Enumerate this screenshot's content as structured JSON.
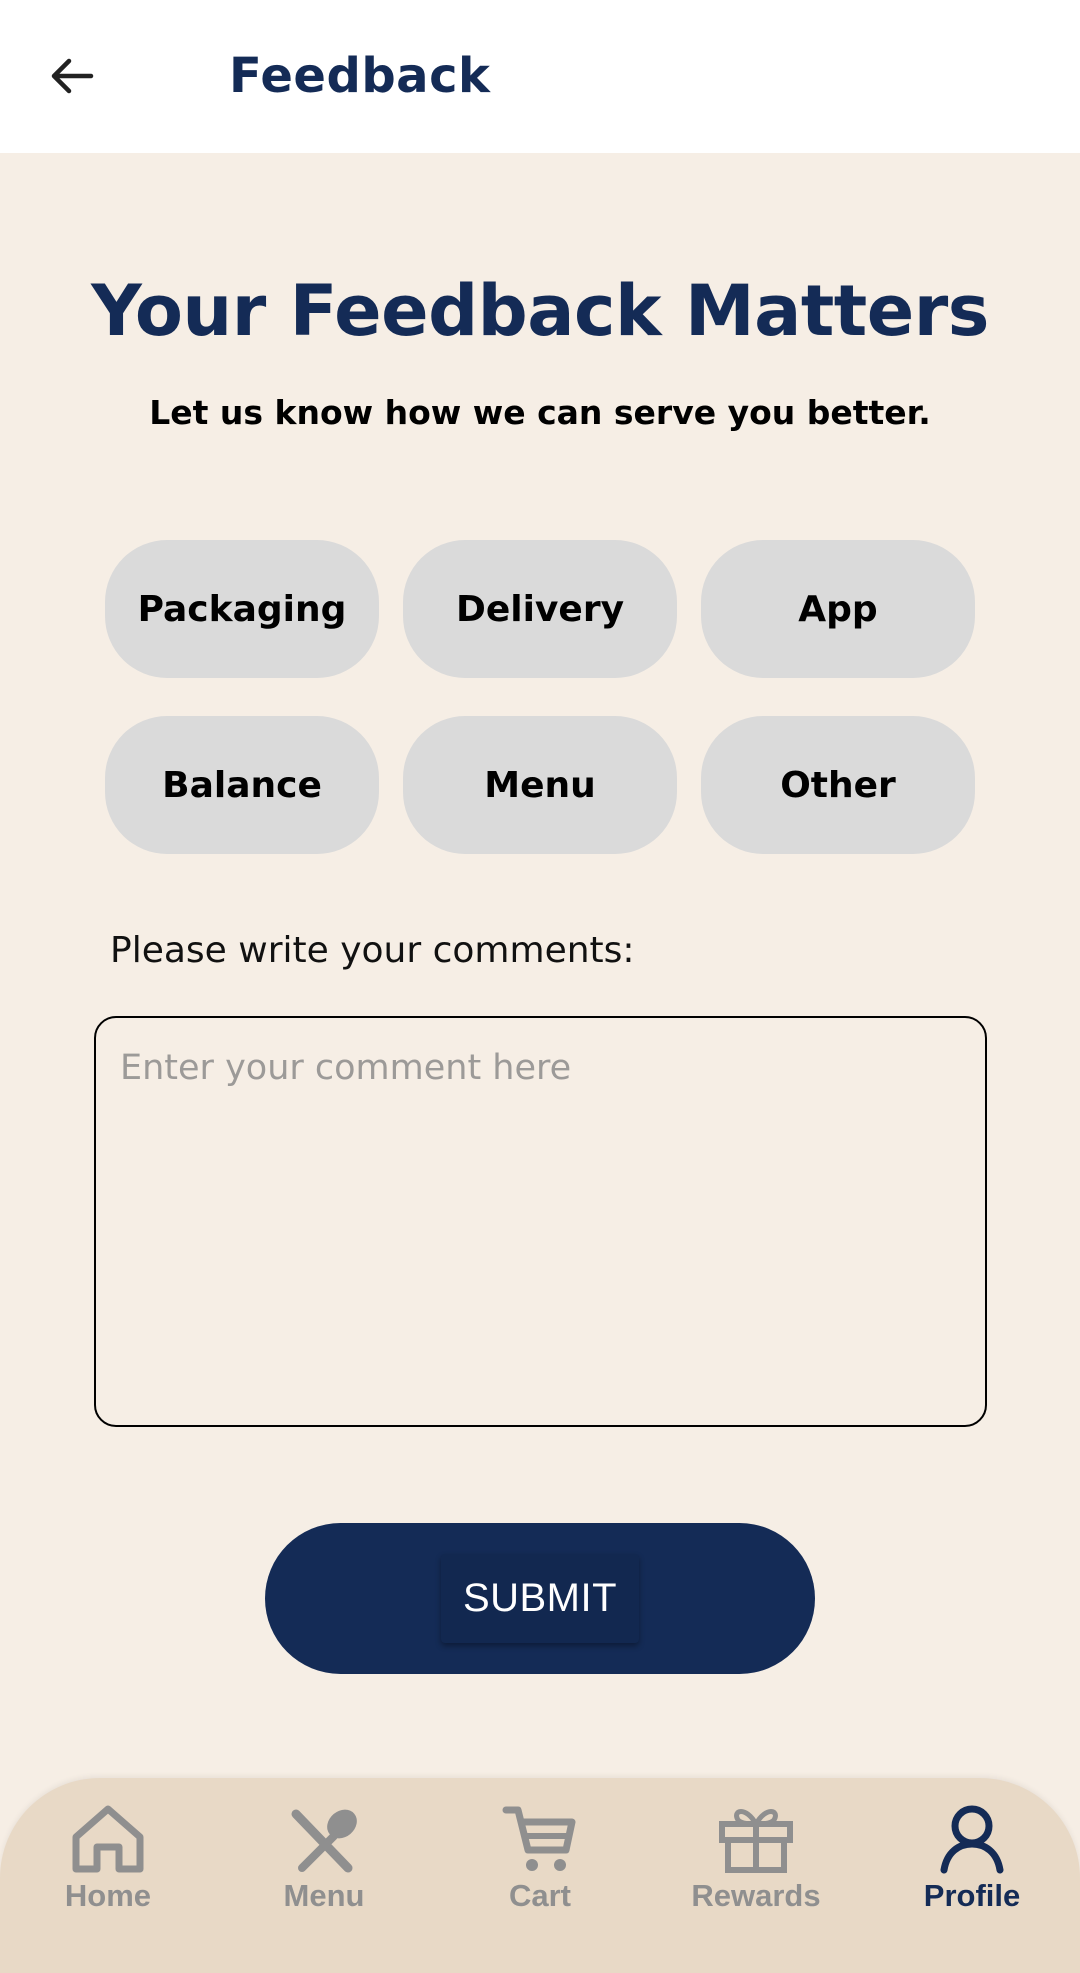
{
  "header": {
    "back_icon": "arrow-left-icon",
    "title": "Feedback"
  },
  "hero": {
    "title": "Your Feedback Matters",
    "subtitle": "Let us know how we can serve you better."
  },
  "categories": [
    {
      "label": "Packaging"
    },
    {
      "label": "Delivery"
    },
    {
      "label": "App"
    },
    {
      "label": "Balance"
    },
    {
      "label": "Menu"
    },
    {
      "label": "Other"
    }
  ],
  "comments": {
    "label": "Please write your comments:",
    "placeholder": "Enter your comment here",
    "value": ""
  },
  "submit": {
    "label": "SUBMIT"
  },
  "nav": {
    "items": [
      {
        "label": "Home",
        "icon": "home-icon",
        "active": false
      },
      {
        "label": "Menu",
        "icon": "utensils-icon",
        "active": false
      },
      {
        "label": "Cart",
        "icon": "cart-icon",
        "active": false
      },
      {
        "label": "Rewards",
        "icon": "gift-icon",
        "active": false
      },
      {
        "label": "Profile",
        "icon": "profile-icon",
        "active": true
      }
    ]
  },
  "colors": {
    "brand_navy": "#142b56",
    "background": "#f6eee5",
    "chip": "#dadada",
    "nav_background": "#e8d9c6",
    "nav_inactive": "#8f8f8f"
  }
}
